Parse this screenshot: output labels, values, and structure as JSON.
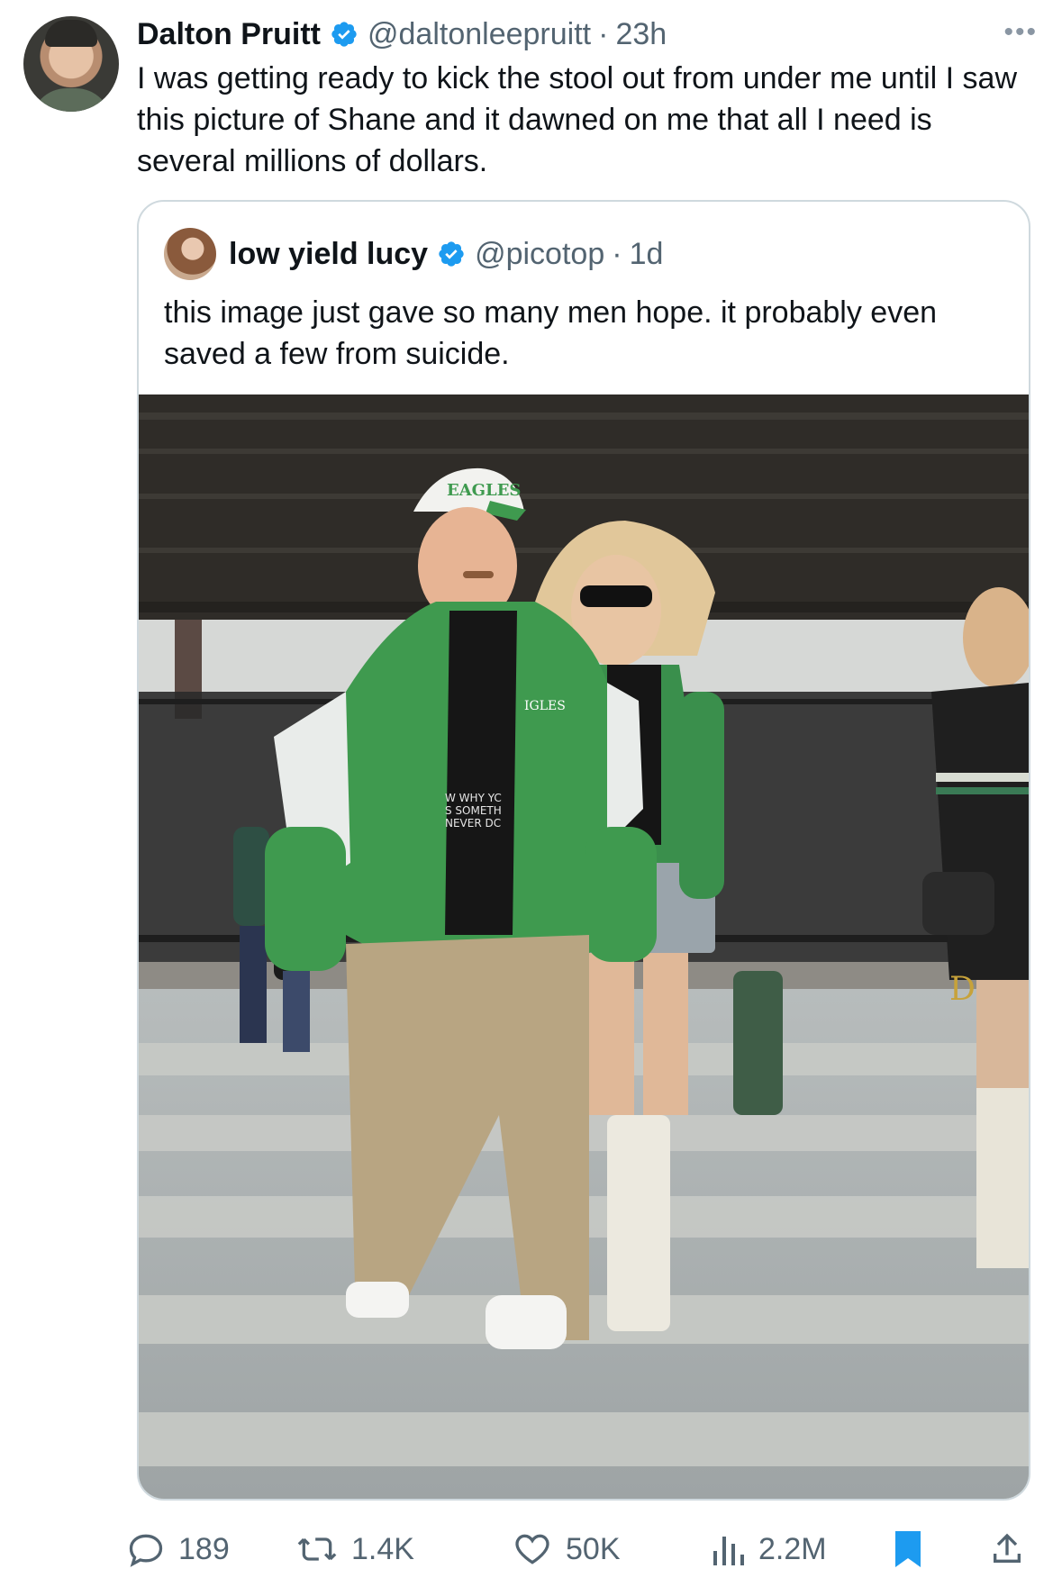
{
  "tweet": {
    "author_name": "Dalton Pruitt",
    "author_handle": "@daltonleepruitt",
    "separator": "·",
    "time": "23h",
    "more_label": "•••",
    "text": "I was getting ready to kick the stool out from under me until I saw this picture of Shane and it dawned on me that all I need is several millions of dollars."
  },
  "quote": {
    "author_name": "low yield lucy",
    "author_handle": "@picotop",
    "separator": "·",
    "time": "1d",
    "text": "this image just gave so many men hope. it probably even saved a few from suicide.",
    "image": {
      "cap_text": "EAGLES",
      "jacket_text": "IGLES",
      "shirt_text_lines": [
        "W WHY YC",
        "S SOMETH",
        "NEVER DC"
      ],
      "bag_logo": "D"
    }
  },
  "actions": {
    "replies": "189",
    "reposts": "1.4K",
    "likes": "50K",
    "views": "2.2M"
  },
  "colors": {
    "verified_blue": "#1d9bf0",
    "bookmark_blue": "#1d9bf0",
    "secondary_text": "#536471",
    "jacket_green": "#3f9a4f"
  },
  "icons": {
    "verified": "verified-badge-icon",
    "reply": "reply-icon",
    "repost": "repost-icon",
    "like": "heart-icon",
    "views": "views-chart-icon",
    "bookmark": "bookmark-icon",
    "share": "share-icon",
    "more": "more-dots-icon"
  }
}
